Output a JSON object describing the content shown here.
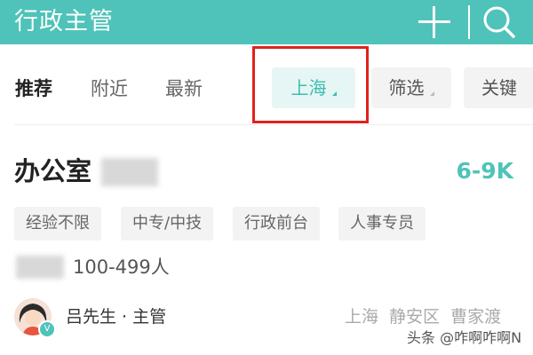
{
  "header": {
    "title": "行政主管",
    "background_color": "#4fc3b9",
    "icons": [
      "plus-icon",
      "search-icon"
    ]
  },
  "filter_bar": {
    "tabs": [
      {
        "label": "推荐",
        "active": true
      },
      {
        "label": "附近",
        "active": false
      },
      {
        "label": "最新",
        "active": false
      }
    ],
    "location_chip": "上海",
    "filter_chip": "筛选",
    "keyword_chip": "关键",
    "highlight_color": "#e0221c"
  },
  "job": {
    "title": "办公室",
    "salary": "6-9K",
    "tags": [
      "经验不限",
      "中专/中技",
      "行政前台",
      "人事专员"
    ],
    "company_size": "100-499人",
    "recruiter": "吕先生 · 主管",
    "location": "上海  静安区  曹家渡"
  },
  "watermark": "头条 @咋啊咋啊N"
}
